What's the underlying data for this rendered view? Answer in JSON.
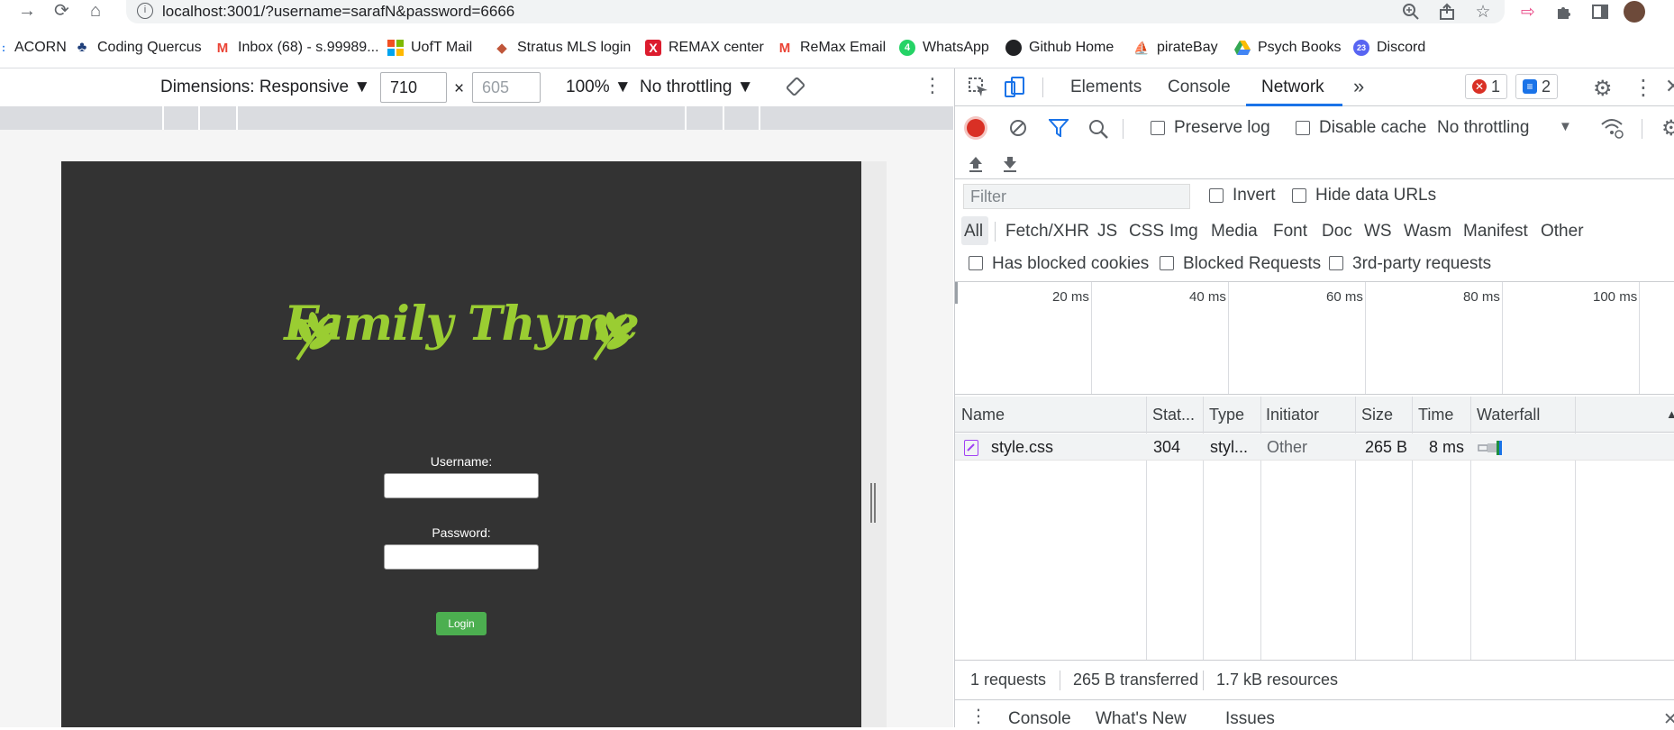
{
  "browser": {
    "url": "localhost:3001/?username=sarafN&password=6666",
    "bookmarks": [
      {
        "label": "ACORN",
        "icon": "acorn-icon"
      },
      {
        "label": "Coding Quercus",
        "icon": "quercus-icon"
      },
      {
        "label": "Inbox (68) - s.99989...",
        "icon": "gmail-icon"
      },
      {
        "label": "UofT Mail",
        "icon": "microsoft-icon"
      },
      {
        "label": "Stratus MLS login",
        "icon": "stratus-icon"
      },
      {
        "label": "REMAX center",
        "icon": "remax-icon"
      },
      {
        "label": "ReMax Email",
        "icon": "gmail-icon"
      },
      {
        "label": "WhatsApp",
        "icon": "whatsapp-icon"
      },
      {
        "label": "Github Home",
        "icon": "github-icon"
      },
      {
        "label": "pirateBay",
        "icon": "pirate-icon"
      },
      {
        "label": "Psych Books",
        "icon": "drive-icon"
      },
      {
        "label": "Discord",
        "icon": "discord-icon"
      }
    ]
  },
  "device_toolbar": {
    "dimensions": "Dimensions: Responsive",
    "width": "710",
    "height_placeholder": "605",
    "times": "×",
    "zoom": "100%",
    "throttling": "No throttling"
  },
  "app": {
    "title": "Family Thyme",
    "username_label": "Username:",
    "password_label": "Password:",
    "login_label": "Login",
    "accent": "#9acd32",
    "button_color": "#4caf50"
  },
  "devtools": {
    "tabs": [
      "Elements",
      "Console",
      "Network"
    ],
    "more": "»",
    "error_count": "1",
    "message_count": "2",
    "preserve_log": "Preserve log",
    "disable_cache": "Disable cache",
    "throttling": "No throttling",
    "filter_placeholder": "Filter",
    "invert": "Invert",
    "hide_data_urls": "Hide data URLs",
    "filter_types": [
      "All",
      "Fetch/XHR",
      "JS",
      "CSS",
      "Img",
      "Media",
      "Font",
      "Doc",
      "WS",
      "Wasm",
      "Manifest",
      "Other"
    ],
    "has_blocked_cookies": "Has blocked cookies",
    "blocked_requests": "Blocked Requests",
    "third_party": "3rd-party requests",
    "timeline_labels": [
      "20 ms",
      "40 ms",
      "60 ms",
      "80 ms",
      "100 ms"
    ],
    "columns": [
      "Name",
      "Stat...",
      "Type",
      "Initiator",
      "Size",
      "Time",
      "Waterfall"
    ],
    "rows": [
      {
        "name": "style.css",
        "status": "304",
        "type": "styl...",
        "initiator": "Other",
        "size": "265 B",
        "time": "8 ms"
      }
    ],
    "summary": {
      "requests": "1 requests",
      "transferred": "265 B transferred",
      "resources": "1.7 kB resources"
    },
    "drawer_tabs": [
      "Console",
      "What's New",
      "Issues"
    ]
  }
}
